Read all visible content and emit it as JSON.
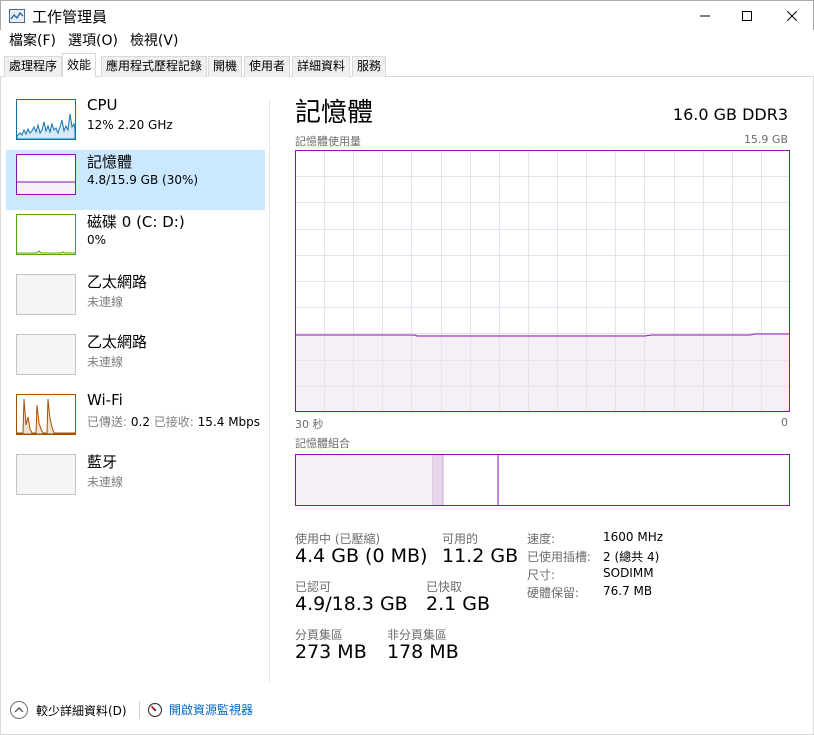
{
  "window": {
    "title": "工作管理員"
  },
  "menu": [
    "檔案(F)",
    "選項(O)",
    "檢視(V)"
  ],
  "tabs": [
    "處理程序",
    "效能",
    "應用程式歷程記錄",
    "開機",
    "使用者",
    "詳細資料",
    "服務"
  ],
  "active_tab": "效能",
  "resources": [
    {
      "name": "CPU",
      "sub": "12%  2.20 GHz",
      "color": "#1174b0"
    },
    {
      "name": "記憶體",
      "sub": "4.8/15.9 GB (30%)",
      "color": "#8b12ae",
      "selected": true
    },
    {
      "name": "磁碟 0 (C: D:)",
      "sub": "0%",
      "color": "#4da60c"
    },
    {
      "name": "乙太網路",
      "sub": "未連線"
    },
    {
      "name": "乙太網路",
      "sub": "未連線"
    },
    {
      "name": "Wi-Fi",
      "send_label": "已傳送:",
      "send_value": "0.2",
      "recv_label": "已接收:",
      "recv_value": "15.4 Mbps",
      "color": "#a74f01"
    },
    {
      "name": "藍牙",
      "sub": "未連線"
    }
  ],
  "detail": {
    "title": "記憶體",
    "spec": "16.0 GB DDR3",
    "usage_graph_label": "記憶體使用量",
    "usage_graph_max": "15.9 GB",
    "time_left": "30 秒",
    "time_right": "0",
    "composition_label": "記憶體組合",
    "usage_fraction": 0.3,
    "stats": {
      "in_use_label": "使用中 (已壓縮)",
      "in_use_value": "4.4 GB (0 MB)",
      "available_label": "可用的",
      "available_value": "11.2 GB",
      "committed_label": "已認可",
      "committed_value": "4.9/18.3 GB",
      "cached_label": "已快取",
      "cached_value": "2.1 GB",
      "paged_label": "分頁集區",
      "paged_value": "273 MB",
      "nonpaged_label": "非分頁集區",
      "nonpaged_value": "178 MB"
    },
    "properties": [
      {
        "key": "速度:",
        "value": "1600 MHz"
      },
      {
        "key": "已使用插槽:",
        "value": "2 (總共 4)"
      },
      {
        "key": "尺寸:",
        "value": "SODIMM"
      },
      {
        "key": "硬體保留:",
        "value": "76.7 MB"
      }
    ]
  },
  "footer": {
    "fewer_details": "較少詳細資料(D)",
    "open_monitor": "開啟資源監視器"
  },
  "colors": {
    "memory_accent": "#8b12ae",
    "selected_bg": "#cce8ff",
    "link": "#0066cc"
  }
}
